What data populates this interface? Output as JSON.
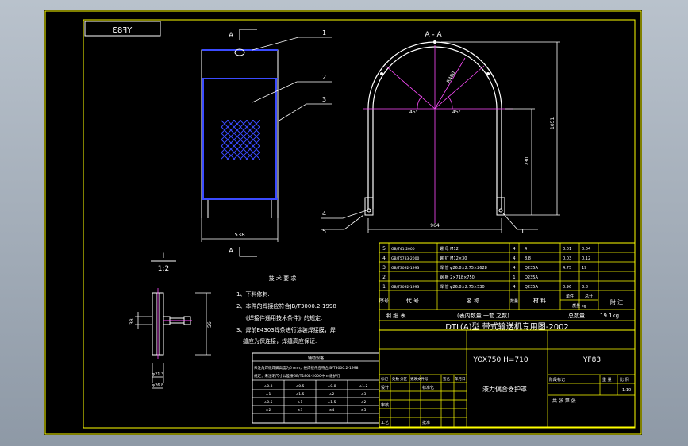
{
  "drawing": {
    "mirrored_code": "YF83",
    "section_mark": "A",
    "section_title": "A - A",
    "callouts": [
      "1",
      "2",
      "3",
      "4",
      "5",
      "1"
    ],
    "dims": {
      "front_width": "538",
      "arch_width": "964",
      "total_height": "1051",
      "radius_note": "R480",
      "side_height": "730",
      "angle_left": "45°",
      "angle_right": "45°",
      "detail_h1": "38",
      "detail_h2": "56",
      "detail_d1": "φ21.3",
      "detail_d2": "φ26.8"
    },
    "detail_label_top": "I",
    "detail_label_bottom": "1:2",
    "tech_req_title": "技 术 要 求",
    "tech_req": [
      "1、下料修刺.",
      "2、本件的焊接应符合JB/T3000.2-1998",
      "《焊接件通用技术条件》的规定.",
      "3、焊前E4303焊条进行涂装焊接膜，焊",
      "缝应为保连接，焊缝高应保证."
    ],
    "tolerance_title": "辅助规格",
    "tolerance_lines": [
      "未注角焊缝焊脚高度为δ mm，按焊接件应符合JB/T3000.2-1998",
      "规定；未注明尺寸公差按GB/T1804-2000中 m级执行"
    ],
    "tolerance_rows": [
      [
        "±0.3",
        "±0.5",
        "±0.8",
        "±1.2"
      ],
      [
        "±1",
        "±1.5",
        "±2",
        "±3"
      ],
      [
        "±0.5",
        "±1",
        "±1.5",
        "±2"
      ],
      [
        "±2",
        "±3",
        "±4",
        "±5"
      ]
    ],
    "parts": [
      {
        "code": "GB/T41-2000",
        "name": "螺 母 M12",
        "qty": "4",
        "mat": "4",
        "w1": "0.01",
        "w2": "0.04"
      },
      {
        "code": "GB/T5783-2000",
        "name": "螺 钉 M12×30",
        "qty": "4",
        "mat": "8.8",
        "w1": "0.03",
        "w2": "0.12"
      },
      {
        "code": "GB/T3092-1993",
        "name": "焊 管 φ26.8×2.75×2628",
        "qty": "4",
        "mat": "Q235A",
        "w1": "4.75",
        "w2": "19"
      },
      {
        "code": "",
        "name": "钢 板 2×718×750",
        "qty": "1",
        "mat": "Q235A",
        "w1": "",
        "w2": ""
      },
      {
        "code": "GB/T3092-1993",
        "name": "焊 管 φ26.8×2.75×530",
        "qty": "4",
        "mat": "Q235A",
        "w1": "0.96",
        "w2": "3.8"
      }
    ],
    "parts_header": [
      "序号",
      "代 号",
      "名 称",
      "数量",
      "材 料",
      "单件",
      "总计",
      "附 注"
    ],
    "mass_label": "质量 kg",
    "summary_left": "明    细    表",
    "summary_mid": "(表内数量    一套    之数)",
    "summary_right": "总数量",
    "total_mass": "19.1kg",
    "series_title": "DTⅡ(A)型  带式输送机专用图-2002",
    "model": "YOX750 H=710",
    "drawing_code": "YF83",
    "part_name": "液力偶合器护罩",
    "stage_label": "阶段标记",
    "weight_label": "重 量",
    "scale_label": "比 例",
    "scale_value": "1:10",
    "sheet_label": "共    张   第    张",
    "revision_header": [
      "标记",
      "处数",
      "分区",
      "更改文件号",
      "签名",
      "年月日"
    ],
    "sign_rows": [
      "设计",
      "审核",
      "工艺"
    ],
    "standardize": "标准化",
    "approve": "批准"
  }
}
